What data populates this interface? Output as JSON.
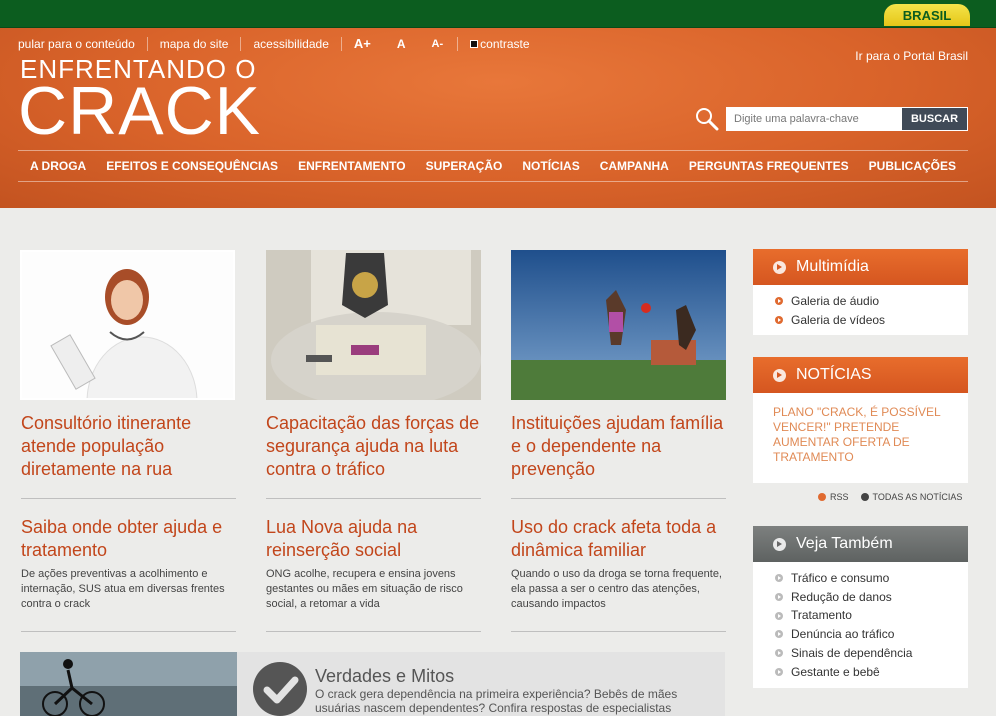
{
  "gov": {
    "brasil_label": "BRASIL"
  },
  "utility": {
    "skip": "pular para o conteúdo",
    "sitemap": "mapa do site",
    "accessibility": "acessibilidade",
    "font_increase": "A+",
    "font_normal": "A",
    "font_decrease": "A-",
    "contrast": "contraste",
    "portal": "Ir para o Portal Brasil"
  },
  "logo": {
    "line1": "ENFRENTANDO O",
    "line2": "CRACK"
  },
  "search": {
    "placeholder": "Digite uma palavra-chave",
    "button": "BUSCAR"
  },
  "nav": [
    "A DROGA",
    "EFEITOS E CONSEQUÊNCIAS",
    "ENFRENTAMENTO",
    "SUPERAÇÃO",
    "NOTÍCIAS",
    "CAMPANHA",
    "PERGUNTAS FREQUENTES",
    "PUBLICAÇÕES"
  ],
  "cards": [
    {
      "title": "Consultório itinerante atende população diretamente na rua"
    },
    {
      "title": "Capacitação das forças de segurança ajuda na luta contra o tráfico"
    },
    {
      "title": "Instituições ajudam família e o dependente na prevenção"
    }
  ],
  "features": [
    {
      "title": "Saiba onde obter ajuda e tratamento",
      "desc": "De ações preventivas a acolhimento e internação, SUS atua em diversas frentes contra o crack"
    },
    {
      "title": "Lua Nova ajuda na reinserção social",
      "desc": "ONG acolhe, recupera e ensina jovens gestantes ou mães em situação de risco social, a retomar a vida"
    },
    {
      "title": "Uso do crack afeta toda a dinâmica familiar",
      "desc": "Quando o uso da droga se torna frequente, ela passa a ser o centro das atenções, causando impactos"
    }
  ],
  "multimedia": {
    "title": "Multimídia",
    "items": [
      "Galeria de áudio",
      "Galeria de vídeos"
    ]
  },
  "news": {
    "title": "NOTÍCIAS",
    "text": "PLANO \"CRACK, É POSSÍVEL VENCER!\" PRETENDE AUMENTAR OFERTA DE TRATAMENTO",
    "rss": "RSS",
    "all": "TODAS AS NOTÍCIAS"
  },
  "see_also": {
    "title": "Veja Também",
    "items": [
      "Tráfico e consumo",
      "Redução de danos",
      "Tratamento",
      "Denúncia ao tráfico",
      "Sinais de dependência",
      "Gestante e bebê"
    ]
  },
  "banner": {
    "title": "Verdades e Mitos",
    "desc": "O crack gera dependência na primeira experiência? Bebês de mães usuárias nascem dependentes? Confira respostas de especialistas"
  },
  "colors": {
    "accent": "#d9632a",
    "gov_green": "#0c5d1f",
    "title_orange": "#c2461b"
  }
}
